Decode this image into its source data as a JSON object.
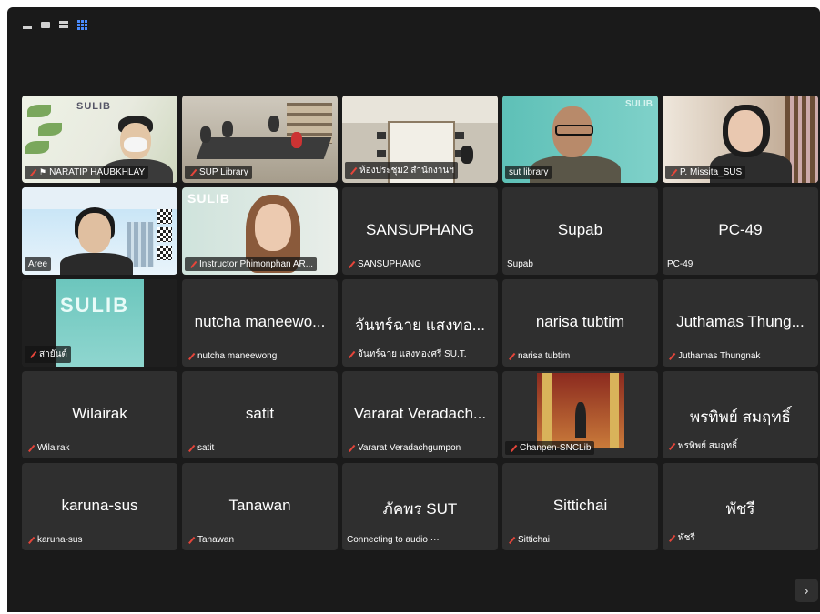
{
  "view_controls": {
    "icons": [
      "minimize-view-icon",
      "speaker-view-icon",
      "strip-view-icon",
      "gallery-view-icon"
    ]
  },
  "participants": [
    {
      "display": "",
      "label": "NARATIP HAUBKHLAY",
      "video": true,
      "scene": "narat",
      "pinned": true,
      "muted": true
    },
    {
      "display": "",
      "label": "SUP Library",
      "video": true,
      "scene": "sup",
      "muted": true
    },
    {
      "display": "",
      "label": "ห้องประชุม2 สำนักงานฯ",
      "video": true,
      "scene": "room",
      "muted": true
    },
    {
      "display": "",
      "label": "sut library",
      "video": true,
      "scene": "sut",
      "muted": false,
      "active_speaker": true
    },
    {
      "display": "",
      "label": "P. Missita_SUS",
      "video": true,
      "scene": "miss",
      "muted": true
    },
    {
      "display": "",
      "label": "Aree",
      "video": true,
      "scene": "aree",
      "muted": false
    },
    {
      "display": "",
      "label": "Instructor Phimonphan AR...",
      "video": true,
      "scene": "inst",
      "muted": true
    },
    {
      "display": "SANSUPHANG",
      "label": "SANSUPHANG",
      "video": false,
      "muted": true
    },
    {
      "display": "Supab",
      "label": "Supab",
      "video": false,
      "muted": false
    },
    {
      "display": "PC-49",
      "label": "PC-49",
      "video": false,
      "muted": false
    },
    {
      "display": "",
      "label": "สายันต์",
      "video": true,
      "scene": "sulib",
      "muted": true
    },
    {
      "display": "nutcha maneewo...",
      "label": "nutcha maneewong",
      "video": false,
      "muted": true
    },
    {
      "display": "จันทร์ฉาย แสงทอ...",
      "label": "จันทร์ฉาย แสงทองศรี SU.T.",
      "video": false,
      "muted": true
    },
    {
      "display": "narisa tubtim",
      "label": "narisa tubtim",
      "video": false,
      "muted": true
    },
    {
      "display": "Juthamas Thung...",
      "label": "Juthamas Thungnak",
      "video": false,
      "muted": true
    },
    {
      "display": "Wilairak",
      "label": "Wilairak",
      "video": false,
      "muted": true
    },
    {
      "display": "satit",
      "label": "satit",
      "video": false,
      "muted": true
    },
    {
      "display": "Vararat Veradach...",
      "label": "Vararat Veradachgumpon",
      "video": false,
      "muted": true
    },
    {
      "display": "",
      "label": "Chanpen-SNCLib",
      "video": true,
      "scene": "chan",
      "muted": true
    },
    {
      "display": "พรทิพย์ สมฤทธิ์",
      "label": "พรทิพย์ สมฤทธิ์",
      "video": false,
      "muted": true
    },
    {
      "display": "karuna-sus",
      "label": "karuna-sus",
      "video": false,
      "muted": true
    },
    {
      "display": "Tanawan",
      "label": "Tanawan",
      "video": false,
      "muted": true
    },
    {
      "display": "ภัคพร SUT",
      "label": "Connecting to audio ···",
      "video": false,
      "muted": false
    },
    {
      "display": "Sittichai",
      "label": "Sittichai",
      "video": false,
      "muted": true
    },
    {
      "display": "พัชรี",
      "label": "พัชรี",
      "video": false,
      "muted": true
    }
  ],
  "thumbnail_text": {
    "narat_sign": "SULIB",
    "sut_brand": "SULIB",
    "inst_brand": "SULIB",
    "sulib_brand": "SULIB"
  },
  "colors": {
    "active_speaker_border": "#2ecc40",
    "muted_icon": "#e6453a",
    "gallery_icon": "#4a8cff"
  }
}
